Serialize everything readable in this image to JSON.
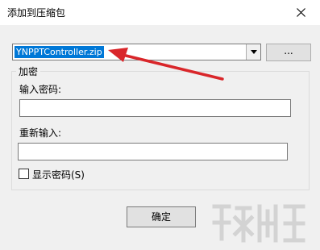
{
  "window": {
    "title": "添加到压缩包"
  },
  "archive": {
    "filename": "YNPPTController.zip",
    "browse_label": "..."
  },
  "encryption": {
    "group_label": "加密",
    "password_label": "输入密码:",
    "password_value": "",
    "confirm_label": "重新输入:",
    "confirm_value": "",
    "show_password_label": "显示密码(S)",
    "show_password_checked": false
  },
  "footer": {
    "ok_label": "确定"
  },
  "annotation": {
    "arrow_color": "#d9262a"
  },
  "icons": [
    "close-icon",
    "chevron-down-icon"
  ]
}
